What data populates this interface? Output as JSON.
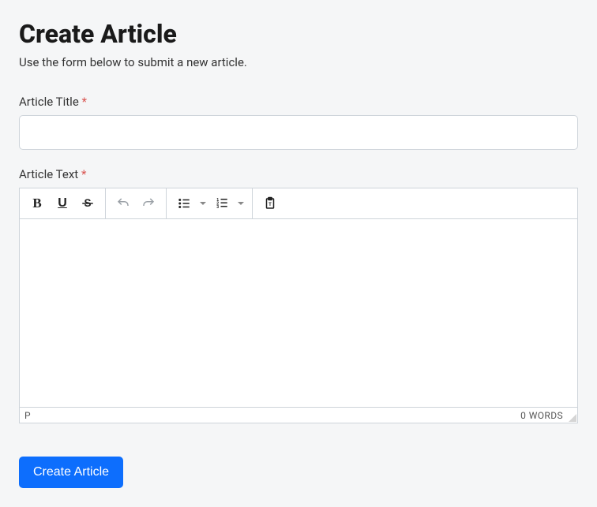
{
  "header": {
    "title": "Create Article",
    "subtitle": "Use the form below to submit a new article."
  },
  "form": {
    "title_field": {
      "label": "Article Title",
      "required_marker": "*",
      "value": ""
    },
    "text_field": {
      "label": "Article Text",
      "required_marker": "*"
    },
    "submit_label": "Create Article"
  },
  "editor": {
    "content": "",
    "status_path": "P",
    "word_count_label": "0 WORDS"
  }
}
